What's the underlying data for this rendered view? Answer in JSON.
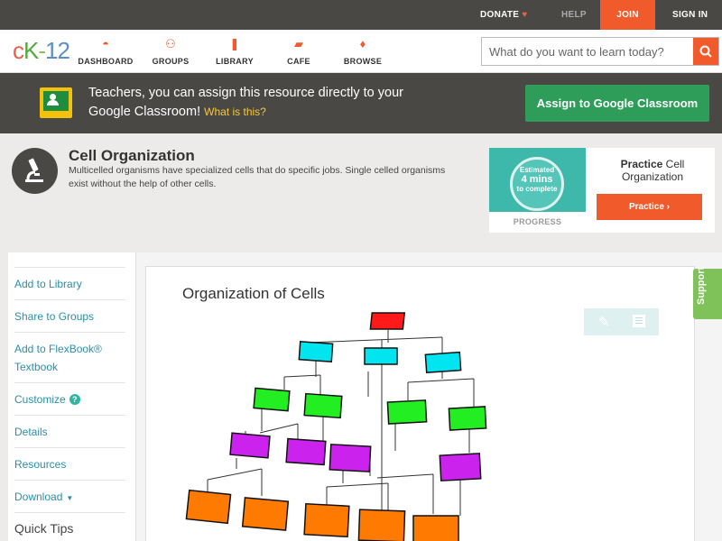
{
  "topbar": {
    "donate": "DONATE",
    "help": "HELP",
    "join": "JOIN",
    "signin": "SIGN IN"
  },
  "logo": {
    "text_c": "c",
    "text_k": "K",
    "text_dash": "-",
    "text_n": "12"
  },
  "nav": [
    {
      "label": "DASHBOARD",
      "icon": "dashboard-icon",
      "glyph": "◓"
    },
    {
      "label": "GROUPS",
      "icon": "groups-icon",
      "glyph": "⚇"
    },
    {
      "label": "LIBRARY",
      "icon": "library-icon",
      "glyph": "❚"
    },
    {
      "label": "CAFE",
      "icon": "cafe-icon",
      "glyph": "▰"
    },
    {
      "label": "BROWSE",
      "icon": "browse-icon",
      "glyph": "♦"
    }
  ],
  "search": {
    "placeholder": "What do you want to learn today?"
  },
  "banner": {
    "text": "Teachers, you can assign this resource directly to your Google Classroom!",
    "what": "What is this?",
    "button": "Assign to Google Classroom"
  },
  "resource": {
    "title": "Cell Organization",
    "description": "Multicelled organisms have specialized cells that do specific jobs. Single celled organisms exist without the help of other cells."
  },
  "practice_card": {
    "ring_line1": "Estimated",
    "ring_line2": "4 mins",
    "ring_line3": "to complete",
    "progress": "PROGRESS",
    "label_bold": "Practice",
    "label_rest": " Cell Organization",
    "button": "Practice"
  },
  "sidebar": {
    "items": [
      {
        "label": "Add to Library"
      },
      {
        "label": "Share to Groups"
      },
      {
        "label": "Add to FlexBook®",
        "label2": "Textbook"
      },
      {
        "label": "Customize"
      },
      {
        "label": "Details"
      },
      {
        "label": "Resources"
      },
      {
        "label": "Download"
      }
    ],
    "quick_tips": "Quick Tips"
  },
  "content": {
    "title": "Organization of Cells",
    "diagram_colors": {
      "root": "#ff1a1a",
      "level1": "#00e5f0",
      "level2": "#22ee22",
      "level3": "#cc22ee",
      "level4": "#ff7a00"
    }
  },
  "support": "Support"
}
